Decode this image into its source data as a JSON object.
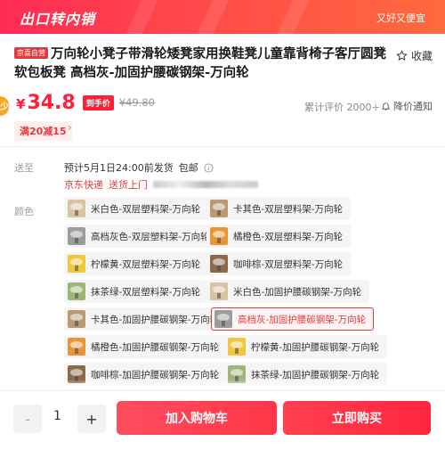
{
  "banner": {
    "title": "出口转内销",
    "slogan": "又好又便宜"
  },
  "product": {
    "self_operated_badge": "京喜自营",
    "title": "万向轮小凳子带滑轮矮凳家用换鞋凳儿童靠背椅子客厅圆凳软包板凳 高档灰-加固护腰碳钢架-万向轮",
    "favorite_label": "收藏"
  },
  "price": {
    "side_tab": "少",
    "currency": "¥",
    "current": "34.8",
    "tag": "到手价",
    "original": "¥49.80",
    "review_count": "累计评价 2000+",
    "alert_label": "降价通知"
  },
  "promo": {
    "label": "满20减15",
    "arrow": "›"
  },
  "delivery": {
    "label": "送至",
    "ship_time": "预计5月1日24:00前发货",
    "free_shipping": "包邮",
    "express": "京东快递",
    "door_delivery": "送货上门"
  },
  "variants": {
    "label": "颜色",
    "options": [
      {
        "name": "米白色-双层塑料架-万向轮",
        "thumb_color": "#d9c3a5",
        "selected": false
      },
      {
        "name": "卡其色-双层塑料架-万向轮",
        "thumb_color": "#b99a73",
        "selected": false
      },
      {
        "name": "高档灰色-双层塑料架-万向轮",
        "thumb_color": "#9c9c9c",
        "selected": false
      },
      {
        "name": "橘橙色-双层塑料架-万向轮",
        "thumb_color": "#e8953a",
        "selected": false
      },
      {
        "name": "柠檬黄-双层塑料架-万向轮",
        "thumb_color": "#f2c740",
        "selected": false
      },
      {
        "name": "咖啡棕-双层塑料架-万向轮",
        "thumb_color": "#8c6a4e",
        "selected": false
      },
      {
        "name": "抹茶绿-双层塑料架-万向轮",
        "thumb_color": "#9fb57a",
        "selected": false
      },
      {
        "name": "米白色-加固护腰碳钢架-万向轮",
        "thumb_color": "#d9c3a5",
        "selected": false
      },
      {
        "name": "卡其色-加固护腰碳钢架-万向轮",
        "thumb_color": "#b99a73",
        "selected": false
      },
      {
        "name": "高档灰-加固护腰碳钢架-万向轮",
        "thumb_color": "#9c9c9c",
        "selected": true
      },
      {
        "name": "橘橙色-加固护腰碳钢架-万向轮",
        "thumb_color": "#e8953a",
        "selected": false
      },
      {
        "name": "柠檬黄-加固护腰碳钢架-万向轮",
        "thumb_color": "#f2c740",
        "selected": false
      },
      {
        "name": "咖啡棕-加固护腰碳钢架-万向轮",
        "thumb_color": "#8c6a4e",
        "selected": false
      },
      {
        "name": "抹茶绿-加固护腰碳钢架-万向轮",
        "thumb_color": "#9fb57a",
        "selected": false
      }
    ]
  },
  "bottom_bar": {
    "minus": "-",
    "quantity": "1",
    "plus": "+",
    "add_to_cart": "加入购物车",
    "buy_now": "立即购买"
  },
  "colors": {
    "brand_red": "#e4393c",
    "price_red": "#ff1f3b"
  }
}
